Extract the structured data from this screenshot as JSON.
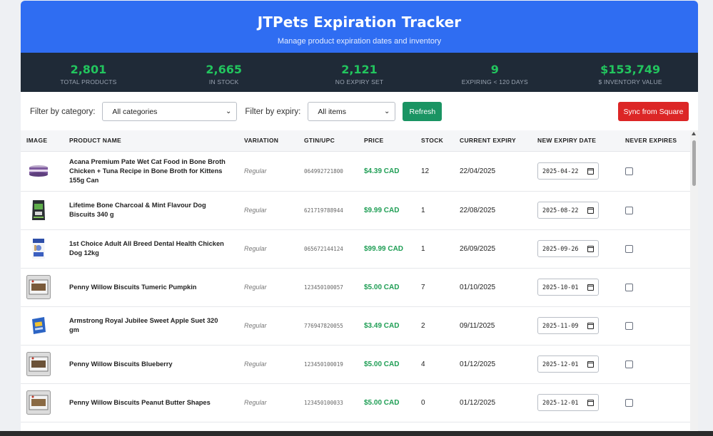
{
  "header": {
    "title": "JTPets Expiration Tracker",
    "subtitle": "Manage product expiration dates and inventory"
  },
  "stats": [
    {
      "value": "2,801",
      "label": "TOTAL PRODUCTS"
    },
    {
      "value": "2,665",
      "label": "IN STOCK"
    },
    {
      "value": "2,121",
      "label": "NO EXPIRY SET"
    },
    {
      "value": "9",
      "label": "EXPIRING < 120 DAYS"
    },
    {
      "value": "$153,749",
      "label": "$ INVENTORY VALUE"
    }
  ],
  "filters": {
    "category_label": "Filter by category:",
    "category_value": "All categories",
    "expiry_label": "Filter by expiry:",
    "expiry_value": "All items",
    "refresh_label": "Refresh",
    "sync_label": "Sync from Square"
  },
  "table": {
    "columns": [
      "IMAGE",
      "PRODUCT NAME",
      "VARIATION",
      "GTIN/UPC",
      "PRICE",
      "STOCK",
      "CURRENT EXPIRY",
      "NEW EXPIRY DATE",
      "NEVER EXPIRES"
    ],
    "rows": [
      {
        "icon": "cat-food-can-icon",
        "name": "Acana Premium Pate Wet Cat Food in Bone Broth Chicken + Tuna Recipe in Bone Broth for Kittens 155g Can",
        "variation": "Regular",
        "upc": "064992721800",
        "price": "$4.39 CAD",
        "stock": "12",
        "current_expiry": "22/04/2025",
        "new_expiry": "2025-04-22",
        "never_expires": false
      },
      {
        "icon": "dog-biscuit-bag-icon",
        "name": "Lifetime Bone Charcoal & Mint Flavour Dog Biscuits 340 g",
        "variation": "Regular",
        "upc": "621719788944",
        "price": "$9.99 CAD",
        "stock": "1",
        "current_expiry": "22/08/2025",
        "new_expiry": "2025-08-22",
        "never_expires": false
      },
      {
        "icon": "dog-food-bag-icon",
        "name": "1st Choice Adult All Breed Dental Health Chicken Dog 12kg",
        "variation": "Regular",
        "upc": "065672144124",
        "price": "$99.99 CAD",
        "stock": "1",
        "current_expiry": "26/09/2025",
        "new_expiry": "2025-09-26",
        "never_expires": false
      },
      {
        "icon": "biscuit-box-icon",
        "name": "Penny Willow Biscuits Tumeric Pumpkin",
        "variation": "Regular",
        "upc": "123450100057",
        "price": "$5.00 CAD",
        "stock": "7",
        "current_expiry": "01/10/2025",
        "new_expiry": "2025-10-01",
        "never_expires": false
      },
      {
        "icon": "treat-box-icon",
        "name": "Armstrong Royal Jubilee Sweet Apple Suet 320 gm",
        "variation": "Regular",
        "upc": "776947820055",
        "price": "$3.49 CAD",
        "stock": "2",
        "current_expiry": "09/11/2025",
        "new_expiry": "2025-11-09",
        "never_expires": false
      },
      {
        "icon": "biscuit-box-icon",
        "name": "Penny Willow Biscuits Blueberry",
        "variation": "Regular",
        "upc": "123450100019",
        "price": "$5.00 CAD",
        "stock": "4",
        "current_expiry": "01/12/2025",
        "new_expiry": "2025-12-01",
        "never_expires": false
      },
      {
        "icon": "biscuit-box-icon",
        "name": "Penny Willow Biscuits Peanut Butter Shapes",
        "variation": "Regular",
        "upc": "123450100033",
        "price": "$5.00 CAD",
        "stock": "0",
        "current_expiry": "01/12/2025",
        "new_expiry": "2025-12-01",
        "never_expires": false
      }
    ]
  },
  "colors": {
    "header_bg": "#2f6df2",
    "stats_bg": "#1f2a37",
    "stat_value": "#22c55e",
    "refresh_bg": "#1a9463",
    "sync_bg": "#dc2626",
    "price_text": "#1f9e55"
  }
}
